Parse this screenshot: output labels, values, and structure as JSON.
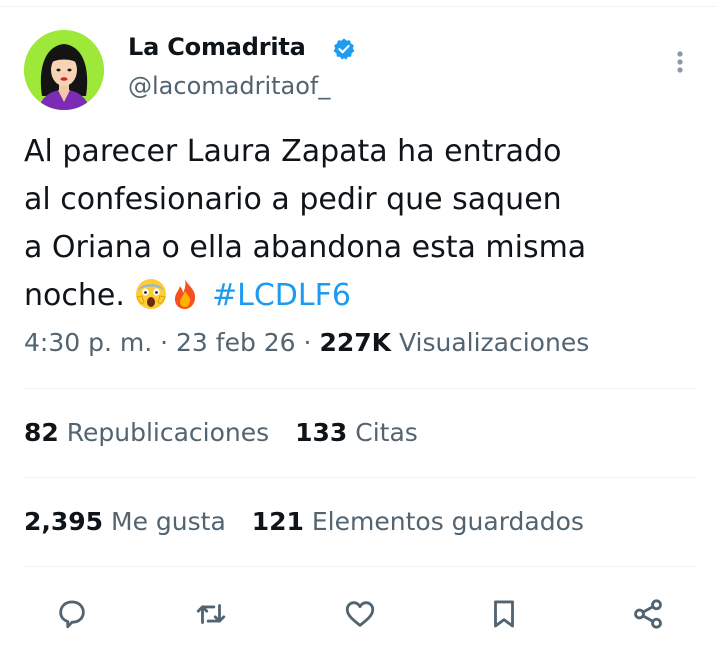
{
  "author": {
    "name": "La Comadrita",
    "handle": "@lacomadritaof_",
    "verified": true,
    "avatar_bg": "#9ee83a"
  },
  "tweet": {
    "line1": "Al parecer Laura Zapata ha entrado",
    "line2": "al confesionario a pedir que saquen",
    "line3": "a Oriana o ella abandona esta misma",
    "line4": "noche.",
    "emojis": [
      "face-screaming-emoji",
      "fire-emoji"
    ],
    "hashtag": "#LCDLF6"
  },
  "meta": {
    "time": "4:30 p. m.",
    "sep": "·",
    "date": "23 feb 26",
    "views_count": "227K",
    "views_label": "Visualizaciones"
  },
  "stats": {
    "reposts_count": "82",
    "reposts_label": "Republicaciones",
    "quotes_count": "133",
    "quotes_label": "Citas",
    "likes_count": "2,395",
    "likes_label": "Me gusta",
    "bookmarks_count": "121",
    "bookmarks_label": "Elementos guardados"
  },
  "actions": [
    "reply-icon",
    "repost-icon",
    "like-icon",
    "bookmark-icon",
    "share-icon"
  ],
  "colors": {
    "accent": "#1d9bf0",
    "secondary_text": "#536471",
    "divider": "#eff3f4"
  }
}
